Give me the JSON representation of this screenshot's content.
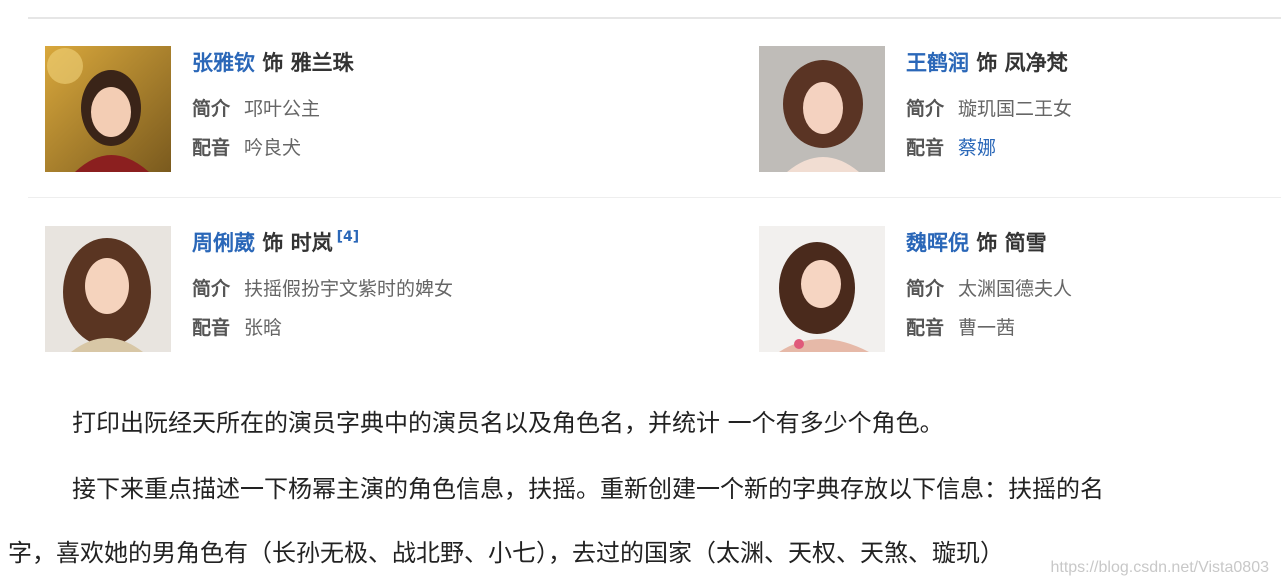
{
  "cast": [
    {
      "actor": "张雅钦",
      "role_sep": "饰",
      "role": "雅兰珠",
      "note": "",
      "intro_label": "简介",
      "intro": "邛叶公主",
      "voice_label": "配音",
      "voice": "吟良犬",
      "voice_is_link": false
    },
    {
      "actor": "王鹤润",
      "role_sep": "饰",
      "role": "凤净梵",
      "note": "",
      "intro_label": "简介",
      "intro": "璇玑国二王女",
      "voice_label": "配音",
      "voice": "蔡娜",
      "voice_is_link": true
    },
    {
      "actor": "周俐葳",
      "role_sep": "饰",
      "role": "时岚",
      "note": "[4]",
      "intro_label": "简介",
      "intro": "扶摇假扮宇文紫时的婢女",
      "voice_label": "配音",
      "voice": "张晗",
      "voice_is_link": false
    },
    {
      "actor": "魏晖倪",
      "role_sep": "饰",
      "role": "简雪",
      "note": "",
      "intro_label": "简介",
      "intro": "太渊国德夫人",
      "voice_label": "配音",
      "voice": "曹一茜",
      "voice_is_link": false
    }
  ],
  "paragraphs": {
    "p1": "打印出阮经天所在的演员字典中的演员名以及角色名，并统计 一个有多少个角色。",
    "p2_line1": "接下来重点描述一下杨幂主演的角色信息，扶摇。重新创建一个新的字典存放以下信息：扶摇的名",
    "p2_line2": "字，喜欢她的男角色有（长孙无极、战北野、小七），去过的国家（太渊、天权、天煞、璇玑）"
  },
  "watermark": "https://blog.csdn.net/Vista0803",
  "colors": {
    "actor_link": "#2a67b8",
    "label": "#555555",
    "value": "#666666"
  }
}
